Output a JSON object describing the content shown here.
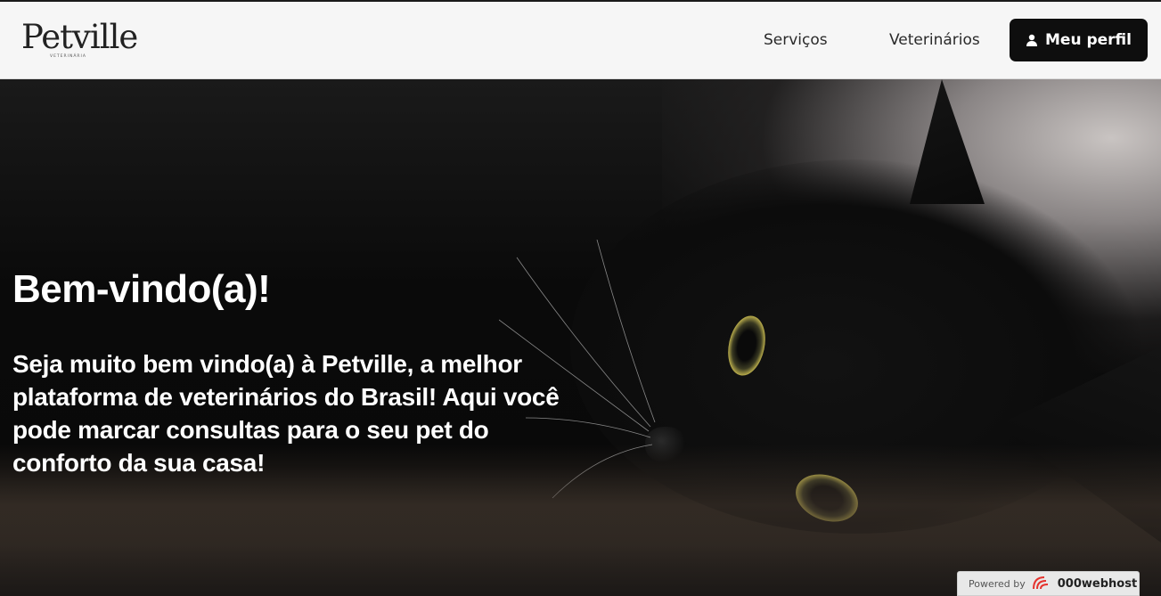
{
  "header": {
    "logo_text": "Petville",
    "logo_subtext": "VETERINÁRIA",
    "nav": [
      {
        "label": "Serviços"
      },
      {
        "label": "Veterinários"
      }
    ],
    "profile_button": {
      "label": "Meu perfil",
      "icon": "user-icon"
    }
  },
  "hero": {
    "title": "Bem-vindo(a)!",
    "text": "Seja muito bem vindo(a) à Petville, a melhor plataforma de veterinários do Brasil! Aqui você pode marcar consultas para o seu pet do conforto da sua casa!",
    "background_image": "black-cat"
  },
  "footer_badge": {
    "prefix": "Powered by",
    "brand": "000webhost",
    "icon": "000webhost-logo-icon"
  },
  "colors": {
    "header_bg": "#f6f6f6",
    "button_bg": "#0e0e0e",
    "text_light": "#ffffff",
    "brand_red": "#e5322d"
  }
}
